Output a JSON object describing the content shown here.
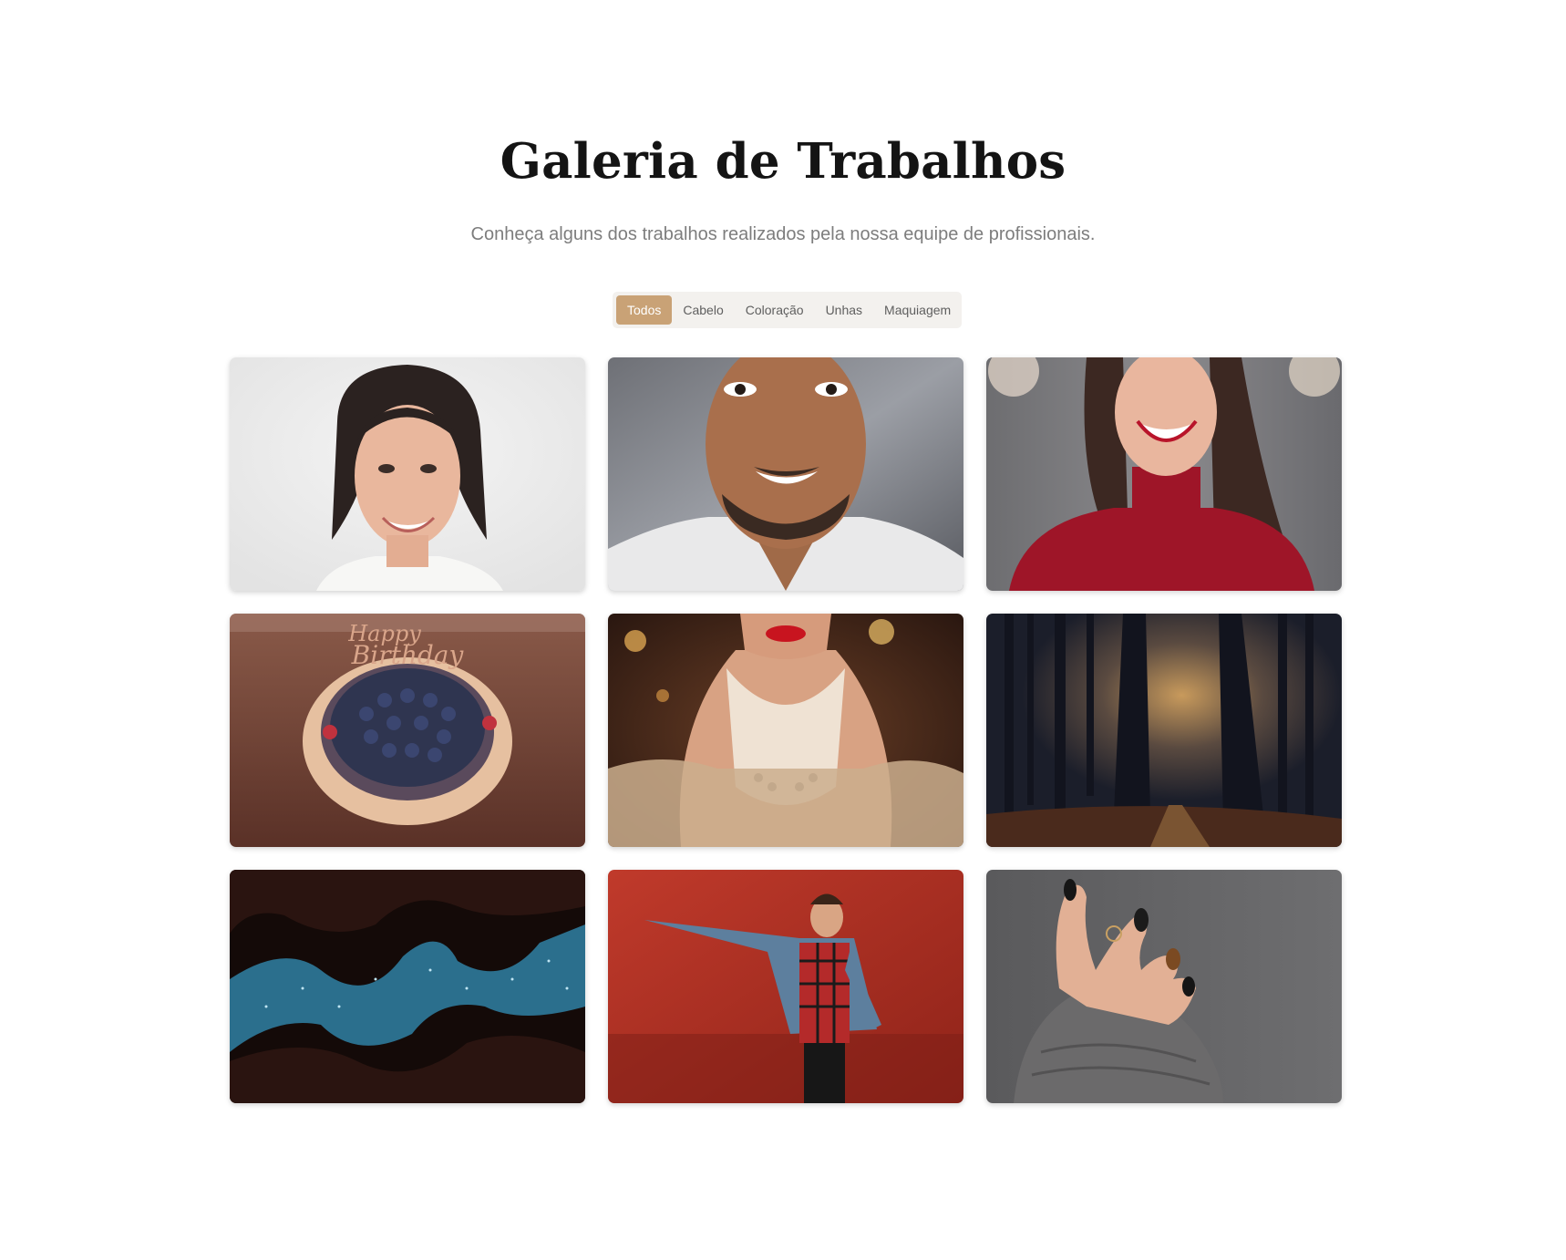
{
  "section": {
    "title": "Galeria de Trabalhos",
    "subtitle": "Conheça alguns dos trabalhos realizados pela nossa equipe de profissionais."
  },
  "filters": [
    {
      "label": "Todos",
      "active": true
    },
    {
      "label": "Cabelo",
      "active": false
    },
    {
      "label": "Coloração",
      "active": false
    },
    {
      "label": "Unhas",
      "active": false
    },
    {
      "label": "Maquiagem",
      "active": false
    }
  ],
  "colors": {
    "accent": "#c9a276",
    "title": "#141414",
    "subtitle": "#7d7d7d",
    "filter_bg": "#f3f1ee"
  },
  "gallery": [
    {
      "icon": "woman-portrait-smiling-photo"
    },
    {
      "icon": "man-portrait-smiling-photo"
    },
    {
      "icon": "woman-red-sweater-laughing-photo"
    },
    {
      "icon": "birthday-cake-photo"
    },
    {
      "icon": "woman-pearl-necklace-photo"
    },
    {
      "icon": "misty-forest-path-photo"
    },
    {
      "icon": "canyon-night-sky-photo"
    },
    {
      "icon": "man-denim-jacket-red-wall-photo"
    },
    {
      "icon": "hand-painted-nails-photo"
    }
  ]
}
